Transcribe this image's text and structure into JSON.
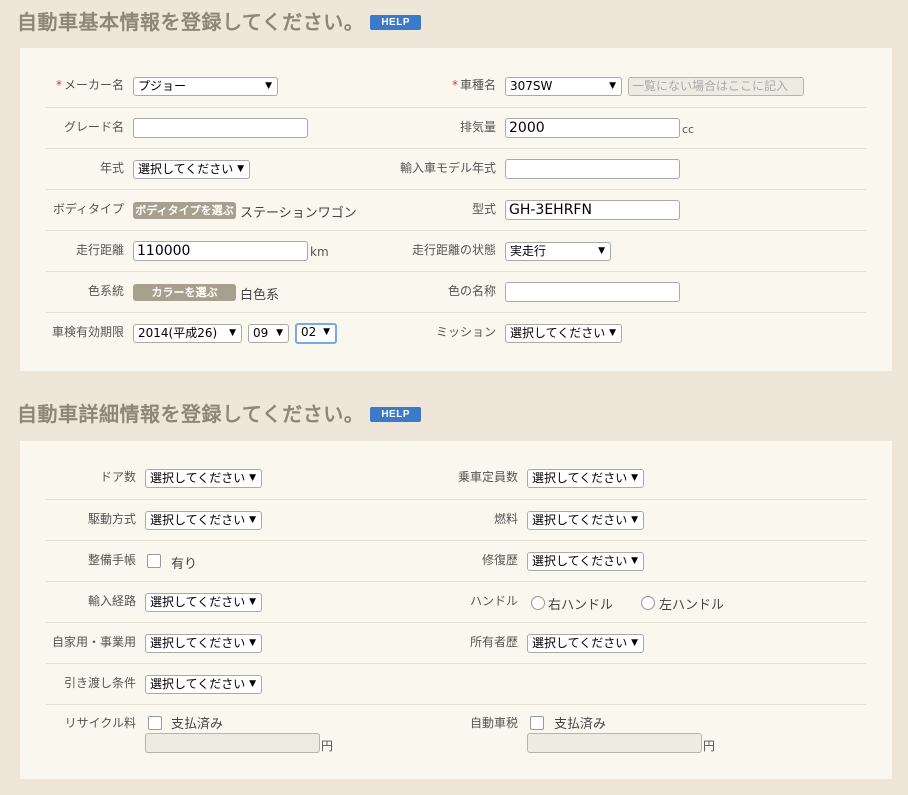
{
  "section1": {
    "title": "自動車基本情報を登録してください。",
    "help": "HELP"
  },
  "section2": {
    "title": "自動車詳細情報を登録してください。",
    "help": "HELP"
  },
  "basic": {
    "maker": {
      "label": "メーカー名",
      "value": "プジョー"
    },
    "car_model": {
      "label": "車種名",
      "value": "307SW",
      "other_placeholder": "一覧にない場合はここに記入"
    },
    "grade": {
      "label": "グレード名",
      "value": ""
    },
    "displacement": {
      "label": "排気量",
      "value": "2000",
      "unit": "cc"
    },
    "year": {
      "label": "年式",
      "value": "選択してください"
    },
    "import_model_year": {
      "label": "輸入車モデル年式",
      "value": ""
    },
    "body_type": {
      "label": "ボディタイプ",
      "button": "ボディタイプを選ぶ",
      "value": "ステーションワゴン"
    },
    "model_code": {
      "label": "型式",
      "value": "GH-3EHRFN"
    },
    "mileage": {
      "label": "走行距離",
      "value": "110000",
      "unit": "km"
    },
    "mileage_state": {
      "label": "走行距離の状態",
      "value": "実走行"
    },
    "color": {
      "label": "色系統",
      "button": "カラーを選ぶ",
      "value": "白色系"
    },
    "color_name": {
      "label": "色の名称",
      "value": ""
    },
    "inspection": {
      "label": "車検有効期限",
      "year": "2014(平成26)",
      "month": "09",
      "day": "02"
    },
    "mission": {
      "label": "ミッション",
      "value": "選択してください"
    }
  },
  "detail": {
    "doors": {
      "label": "ドア数",
      "value": "選択してください"
    },
    "capacity": {
      "label": "乗車定員数",
      "value": "選択してください"
    },
    "drive": {
      "label": "駆動方式",
      "value": "選択してください"
    },
    "fuel": {
      "label": "燃料",
      "value": "選択してください"
    },
    "maintenance": {
      "label": "整備手帳",
      "option": "有り"
    },
    "repair": {
      "label": "修復歴",
      "value": "選択してください"
    },
    "import_route": {
      "label": "輸入経路",
      "value": "選択してください"
    },
    "handle": {
      "label": "ハンドル",
      "right": "右ハンドル",
      "left": "左ハンドル"
    },
    "usage": {
      "label": "自家用・事業用",
      "value": "選択してください"
    },
    "owners": {
      "label": "所有者歴",
      "value": "選択してください"
    },
    "delivery": {
      "label": "引き渡し条件",
      "value": "選択してください"
    },
    "recycle": {
      "label": "リサイクル料",
      "check": "支払済み",
      "unit": "円"
    },
    "car_tax": {
      "label": "自動車税",
      "check": "支払済み",
      "unit": "円"
    }
  },
  "colors": {
    "help": "#3b7ac9",
    "required": "#d33333",
    "choose_button": "#a8a08e"
  }
}
